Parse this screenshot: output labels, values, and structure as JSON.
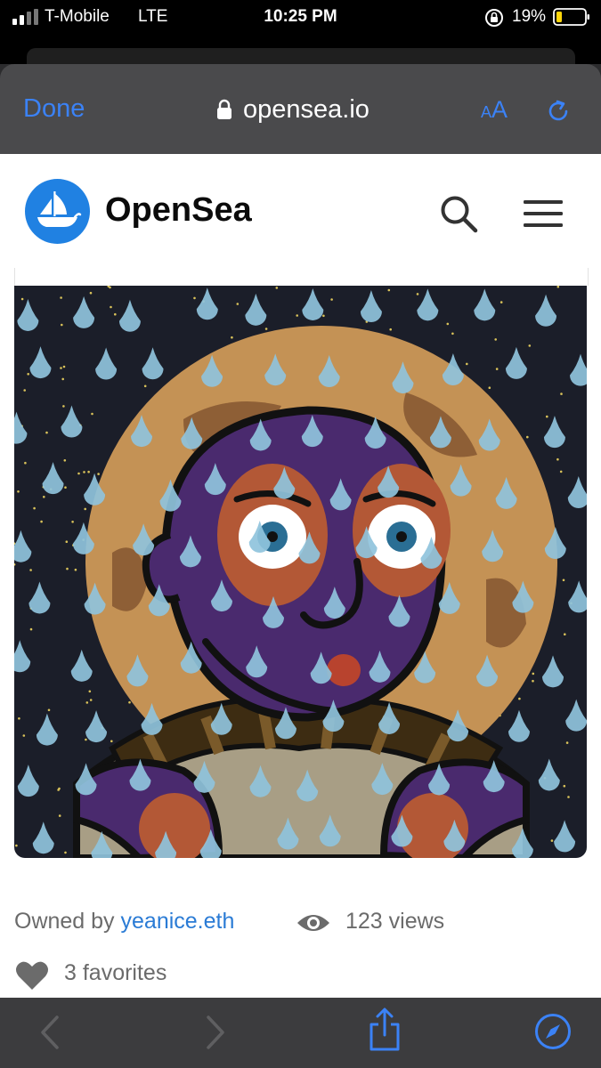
{
  "status_bar": {
    "carrier": "T-Mobile",
    "network": "LTE",
    "time": "10:25 PM",
    "battery_percent": "19%"
  },
  "browser": {
    "done_label": "Done",
    "url": "opensea.io",
    "text_size_small": "A",
    "text_size_large": "A",
    "accent_color": "#3b82f6"
  },
  "site": {
    "brand": "OpenSea",
    "brand_color": "#2081e2"
  },
  "nft": {
    "artwork_icon": "raining-portrait-artwork",
    "owned_by_label": "Owned by",
    "owner": "yeanice.eth",
    "views": "123 views",
    "favorites": "3 favorites"
  }
}
